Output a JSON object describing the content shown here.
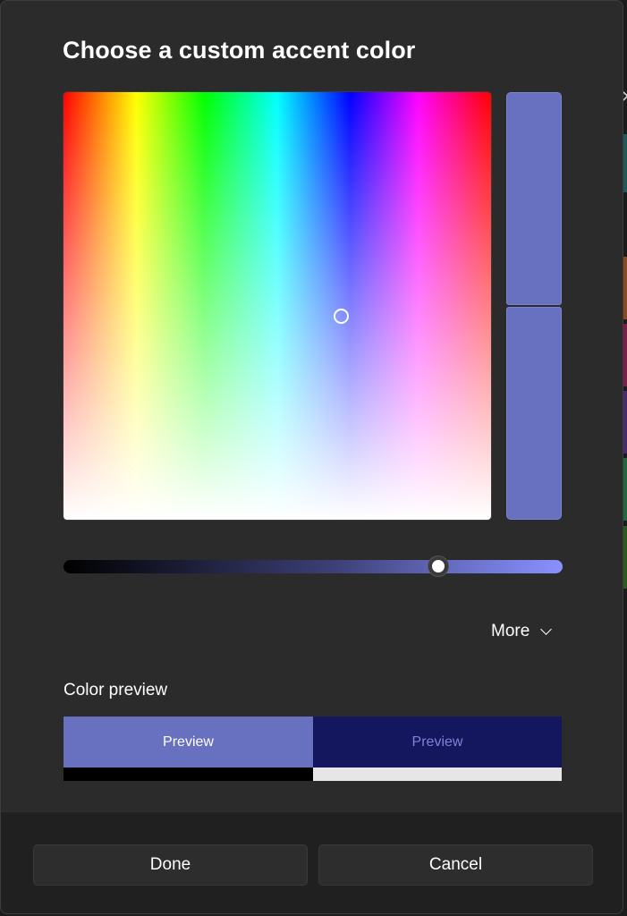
{
  "dialog": {
    "title": "Choose a custom accent color",
    "selected_color": "#6870c0",
    "value_slider_level": 0.75,
    "more_label": "More",
    "color_preview": {
      "label": "Color preview",
      "light_text": "Preview",
      "dark_text": "Preview",
      "light_bg": "#6870c0",
      "dark_bg": "#14165e"
    },
    "buttons": {
      "done": "Done",
      "cancel": "Cancel"
    }
  },
  "icons": {
    "more": "chevron-down-icon",
    "background_close": "close-icon"
  }
}
